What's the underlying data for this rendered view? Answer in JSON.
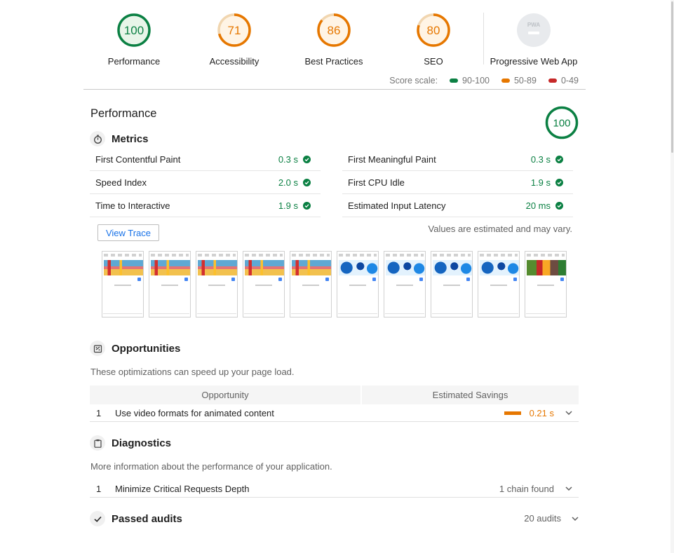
{
  "colors": {
    "pass": "#0b8043",
    "average": "#e67700",
    "fail": "#c62828",
    "muted": "#9e9e9e"
  },
  "categories": [
    {
      "score": "100",
      "label": "Performance",
      "rating": "pass"
    },
    {
      "score": "71",
      "label": "Accessibility",
      "rating": "average"
    },
    {
      "score": "86",
      "label": "Best Practices",
      "rating": "average"
    },
    {
      "score": "80",
      "label": "SEO",
      "rating": "average"
    }
  ],
  "pwa": {
    "badge": "PWA",
    "label": "Progressive Web App"
  },
  "score_scale": {
    "label": "Score scale:",
    "ranges": [
      "90-100",
      "50-89",
      "0-49"
    ]
  },
  "performance": {
    "title": "Performance",
    "score": "100",
    "metrics_title": "Metrics",
    "metrics": [
      {
        "name": "First Contentful Paint",
        "value": "0.3 s"
      },
      {
        "name": "First Meaningful Paint",
        "value": "0.3 s"
      },
      {
        "name": "Speed Index",
        "value": "2.0 s"
      },
      {
        "name": "First CPU Idle",
        "value": "1.9 s"
      },
      {
        "name": "Time to Interactive",
        "value": "1.9 s"
      },
      {
        "name": "Estimated Input Latency",
        "value": "20 ms"
      }
    ],
    "view_trace": "View Trace",
    "estimated_note": "Values are estimated and may vary."
  },
  "filmstrip_frames": 10,
  "opportunities": {
    "title": "Opportunities",
    "description": "These optimizations can speed up your page load.",
    "col_opportunity": "Opportunity",
    "col_savings": "Estimated Savings",
    "items": [
      {
        "num": "1",
        "name": "Use video formats for animated content",
        "savings": "0.21 s"
      }
    ]
  },
  "diagnostics": {
    "title": "Diagnostics",
    "description": "More information about the performance of your application.",
    "items": [
      {
        "num": "1",
        "name": "Minimize Critical Requests Depth",
        "detail": "1 chain found"
      }
    ]
  },
  "passed": {
    "title": "Passed audits",
    "count": "20 audits"
  }
}
